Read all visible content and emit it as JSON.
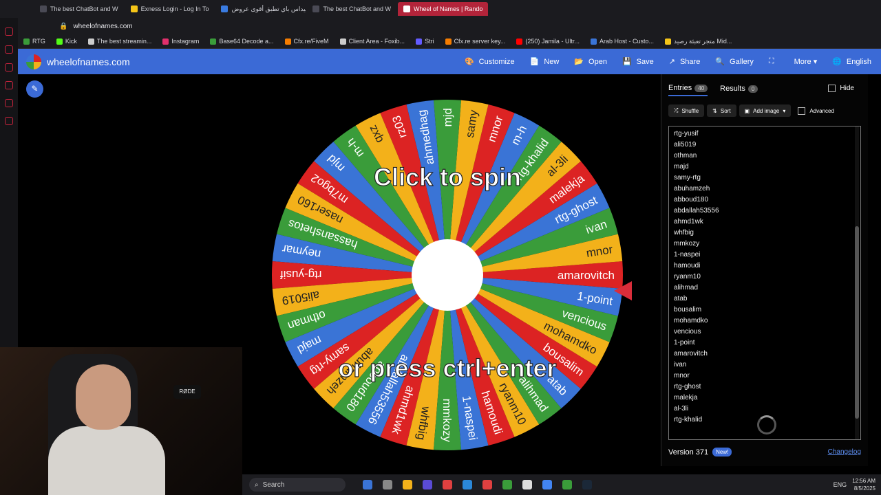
{
  "browser": {
    "tabs": [
      {
        "label": "The best ChatBot and W",
        "color": "#4a4a55"
      },
      {
        "label": "Exness Login - Log In To",
        "color": "#f5c518"
      },
      {
        "label": "ميداس باي تطبق أقوى عروض",
        "color": "#3a7be0"
      },
      {
        "label": "The best ChatBot and W",
        "color": "#4a4a55"
      },
      {
        "label": "Wheel of Names | Rando",
        "color": "#ffffff"
      }
    ],
    "url": "wheelofnames.com",
    "bookmarks": [
      {
        "label": "RTG",
        "color": "#3a9c3a"
      },
      {
        "label": "Kick",
        "color": "#53fc18"
      },
      {
        "label": "The best streamin...",
        "color": "#cccccc"
      },
      {
        "label": "Instagram",
        "color": "#e1306c"
      },
      {
        "label": "Base64 Decode a...",
        "color": "#3a9c3a"
      },
      {
        "label": "Cfx.re/FiveM",
        "color": "#f57c00"
      },
      {
        "label": "Client Area - Foxib...",
        "color": "#cccccc"
      },
      {
        "label": "Stri",
        "color": "#635bff"
      },
      {
        "label": "Cfx.re server key...",
        "color": "#f57c00"
      },
      {
        "label": "(250) Jamila - Ultr...",
        "color": "#ff0000"
      },
      {
        "label": "Arab Host - Custo...",
        "color": "#3a74d6"
      },
      {
        "label": "متجر تعبئة رصيد Mid...",
        "color": "#f5c518"
      }
    ]
  },
  "app": {
    "site_name": "wheelofnames.com",
    "menu": [
      {
        "label": "Customize",
        "icon": "🎨"
      },
      {
        "label": "New",
        "icon": "📄"
      },
      {
        "label": "Open",
        "icon": "📂"
      },
      {
        "label": "Save",
        "icon": "💾"
      },
      {
        "label": "Share",
        "icon": "↗"
      },
      {
        "label": "Gallery",
        "icon": "🔍"
      },
      {
        "label": "",
        "icon": "⛶"
      },
      {
        "label": "More ▾",
        "icon": ""
      },
      {
        "label": "English",
        "icon": "🌐"
      }
    ]
  },
  "wheel": {
    "center_top_text": "Click to spin",
    "center_bottom_text": "or press ctrl+enter",
    "colors": [
      "#dc2323",
      "#f3b11a",
      "#3a9c3a",
      "#3a74d6"
    ],
    "segments": [
      "amarovitch",
      "mnor",
      "ivan",
      "rtg-ghost",
      "malekja",
      "al-3li",
      "rtg-khalid",
      "m-h",
      "mnor",
      "samy",
      "mjd",
      "ahmedhag",
      "rz03",
      "qxz",
      "m-h",
      "mjd",
      "m7bgo2",
      "naser160",
      "hassanshetos",
      "neymar",
      "rtg-yusif",
      "ali5019",
      "othman",
      "majd",
      "samy-rtg",
      "abuhamzeh",
      "abboud180",
      "abdallah53556",
      "ahmd1wk",
      "whfbig",
      "mmkozy",
      "1-naspei",
      "hamoudi",
      "ryanm10",
      "alihmad",
      "atab",
      "bousalim",
      "mohamdko",
      "vencious",
      "1-point"
    ]
  },
  "panel": {
    "tab_entries": "Entries",
    "entries_count": "40",
    "tab_results": "Results",
    "results_count": "0",
    "hide_label": "Hide",
    "shuffle_label": "Shuffle",
    "sort_label": "Sort",
    "add_image_label": "Add image",
    "advanced_label": "Advanced",
    "entries": [
      "rtg-yusif",
      "ali5019",
      "othman",
      "majd",
      "samy-rtg",
      "abuhamzeh",
      "abboud180",
      "abdallah53556",
      "ahmd1wk",
      "whfbig",
      "mmkozy",
      "1-naspei",
      "hamoudi",
      "ryanm10",
      "alihmad",
      "atab",
      "bousalim",
      "mohamdko",
      "vencious",
      "1-point",
      "amarovitch",
      "ivan",
      "mnor",
      "rtg-ghost",
      "malekja",
      "al-3li",
      "rtg-khalid"
    ],
    "version": "Version 371",
    "new_badge": "New!",
    "changelog": "Changelog"
  },
  "webcam": {
    "mic_label": "RØDE"
  },
  "taskbar": {
    "search_placeholder": "Search",
    "lang": "ENG",
    "time": "12:56 AM",
    "date": "8/5/2025",
    "apps": [
      "#3a74d6",
      "#888888",
      "#f3b11a",
      "#5a4bd6",
      "#e04040",
      "#2b88d8",
      "#e04040",
      "#3a9c3a",
      "#dddddd",
      "#4285f4",
      "#3a9c3a",
      "#1b2838"
    ]
  }
}
